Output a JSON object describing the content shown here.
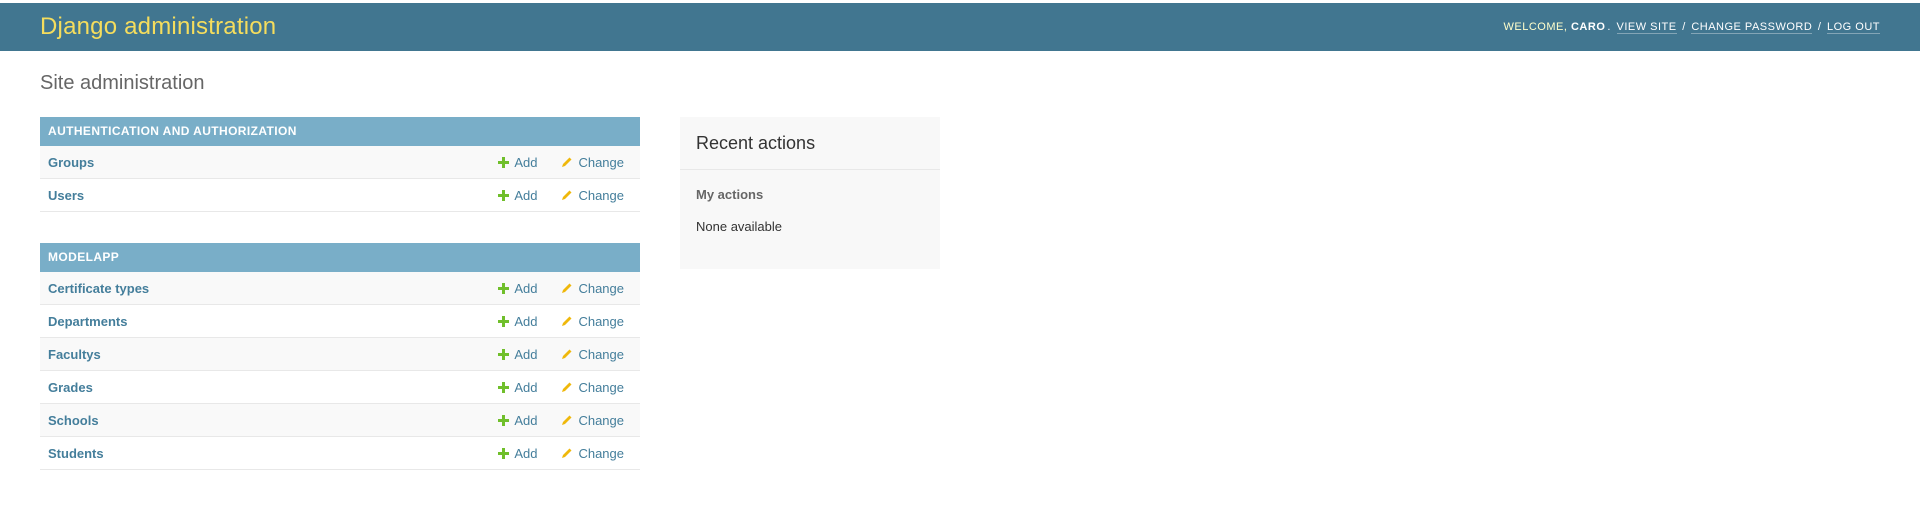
{
  "header": {
    "branding": "Django administration",
    "welcome": "Welcome,",
    "username": "caro",
    "view_site": "View site",
    "change_password": "Change password",
    "log_out": "Log out"
  },
  "page_title": "Site administration",
  "modules": [
    {
      "caption": "Authentication and Authorization",
      "models": [
        {
          "name": "Groups",
          "add": "Add",
          "change": "Change"
        },
        {
          "name": "Users",
          "add": "Add",
          "change": "Change"
        }
      ]
    },
    {
      "caption": "Modelapp",
      "models": [
        {
          "name": "Certificate types",
          "add": "Add",
          "change": "Change"
        },
        {
          "name": "Departments",
          "add": "Add",
          "change": "Change"
        },
        {
          "name": "Facultys",
          "add": "Add",
          "change": "Change"
        },
        {
          "name": "Grades",
          "add": "Add",
          "change": "Change"
        },
        {
          "name": "Schools",
          "add": "Add",
          "change": "Change"
        },
        {
          "name": "Students",
          "add": "Add",
          "change": "Change"
        }
      ]
    }
  ],
  "recent_actions": {
    "title": "Recent actions",
    "subtitle": "My actions",
    "empty": "None available"
  },
  "icons": {
    "add": "plus-icon",
    "change": "pencil-icon"
  },
  "colors": {
    "header_bg": "#417690",
    "branding": "#f5dd5d",
    "caption_bg": "#79aec8",
    "link": "#447e9b",
    "add_icon": "#70bf2b",
    "change_icon": "#efb80b"
  }
}
